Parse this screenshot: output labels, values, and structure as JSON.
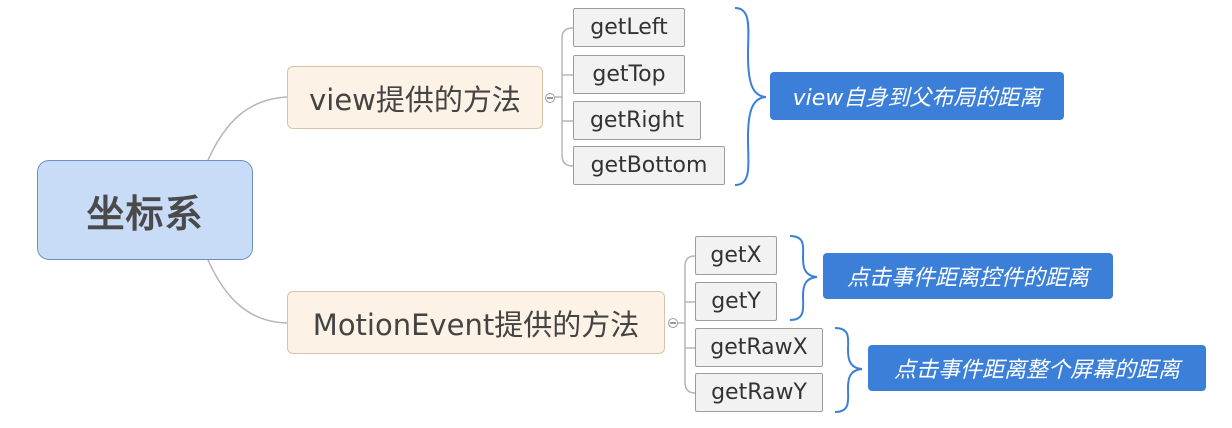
{
  "diagram": {
    "root": "坐标系",
    "branches": [
      {
        "label": "view提供的方法",
        "children": [
          "getLeft",
          "getTop",
          "getRight",
          "getBottom"
        ],
        "notes": [
          "view自身到父布局的距离"
        ]
      },
      {
        "label": "MotionEvent提供的方法",
        "children": [
          "getX",
          "getY",
          "getRawX",
          "getRawY"
        ],
        "notes": [
          "点击事件距离控件的距离",
          "点击事件距离整个屏幕的距离"
        ]
      }
    ]
  },
  "colors": {
    "root_fill": "#c9dcf7",
    "branch_fill": "#fdf2e6",
    "leaf_fill": "#f2f2f2",
    "note_fill": "#3b7fd9",
    "connector": "#b5b5b5",
    "brace": "#3b7fd9"
  },
  "icons": [
    "collapse-icon"
  ]
}
